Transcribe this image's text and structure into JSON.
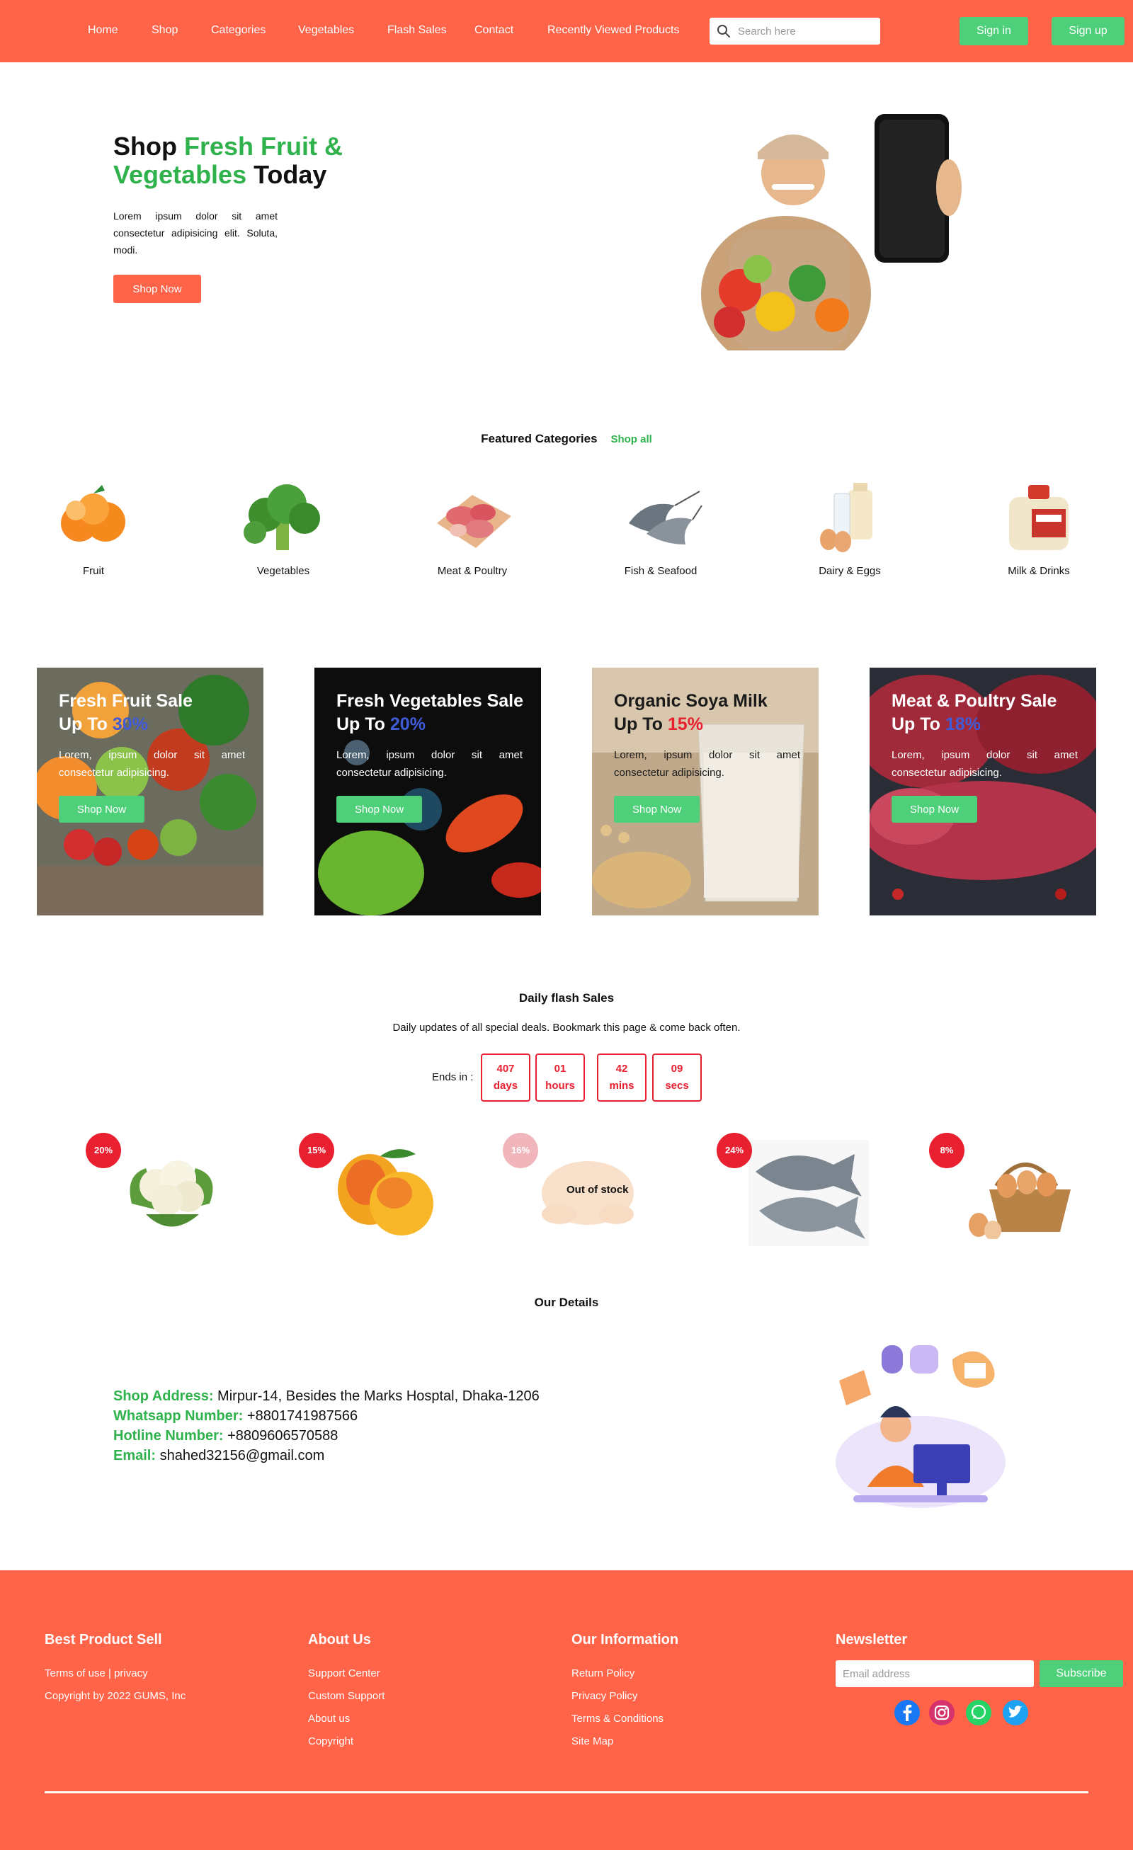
{
  "nav": {
    "items": [
      "Home",
      "Shop",
      "Categories",
      "Vegetables",
      "Flash Sales",
      "Contact",
      "Recently Viewed Products"
    ],
    "search_placeholder": "Search here",
    "signin": "Sign in",
    "signup": "Sign up"
  },
  "hero": {
    "title_pre": "Shop ",
    "title_green1": "Fresh Fruit &",
    "title_green2": "Vegetables",
    "title_post": " Today",
    "description": "Lorem ipsum dolor sit amet consectetur adipisicing elit. Soluta, modi.",
    "cta": "Shop Now"
  },
  "featured": {
    "title": "Featured Categories",
    "shop_all": "Shop all",
    "categories": [
      "Fruit",
      "Vegetables",
      "Meat & Poultry",
      "Fish & Seafood",
      "Dairy & Eggs",
      "Milk & Drinks"
    ]
  },
  "promos": [
    {
      "title": "Fresh Fruit Sale",
      "up_to": "Up To ",
      "pct": "30%",
      "pct_color": "#3f5bd8",
      "desc": "Lorem, ipsum dolor sit amet consectetur adipisicing.",
      "cta": "Shop Now"
    },
    {
      "title": "Fresh Vegetables Sale",
      "up_to": "Up To ",
      "pct": "20%",
      "pct_color": "#3f5bd8",
      "desc": "Lorem, ipsum dolor sit amet consectetur adipisicing.",
      "cta": "Shop Now"
    },
    {
      "title": "Organic Soya Milk",
      "up_to": "Up To ",
      "pct": "15%",
      "pct_color": "#e82030",
      "desc": "Lorem, ipsum dolor sit amet consectetur adipisicing.",
      "cta": "Shop Now"
    },
    {
      "title": "Meat & Poultry Sale",
      "up_to": "Up To ",
      "pct": "18%",
      "pct_color": "#3f5bd8",
      "desc": "Lorem, ipsum dolor sit amet consectetur adipisicing.",
      "cta": "Shop Now"
    }
  ],
  "flash": {
    "title": "Daily flash Sales",
    "subtitle": "Daily updates of all special deals. Bookmark this page & come back often.",
    "ends_in": "Ends in :",
    "timers": [
      {
        "value": "407",
        "unit": "days"
      },
      {
        "value": "01",
        "unit": "hours"
      },
      {
        "value": "42",
        "unit": "mins"
      },
      {
        "value": "09",
        "unit": "secs"
      }
    ],
    "products": [
      {
        "discount": "20%",
        "icon": "cauliflower-image"
      },
      {
        "discount": "15%",
        "icon": "mango-image"
      },
      {
        "discount": "16%",
        "icon": "chicken-image",
        "status": "Out of stock"
      },
      {
        "discount": "24%",
        "icon": "fish-image"
      },
      {
        "discount": "8%",
        "icon": "eggs-basket-image"
      }
    ]
  },
  "details": {
    "title": "Our Details",
    "rows": [
      {
        "key": "Shop Address:",
        "value": " Mirpur-14, Besides the Marks Hosptal, Dhaka-1206"
      },
      {
        "key": "Whatsapp Number:",
        "value": " +8801741987566"
      },
      {
        "key": "Hotline Number:",
        "value": " +8809606570588"
      },
      {
        "key": "Email:",
        "value": " shahed32156@gmail.com"
      }
    ]
  },
  "footer": {
    "col1": {
      "title": "Best Product Sell",
      "links": [
        "Terms of use | privacy",
        "Copyright by 2022 GUMS, Inc"
      ]
    },
    "col2": {
      "title": "About Us",
      "links": [
        "Support Center",
        "Custom Support",
        "About us",
        "Copyright"
      ]
    },
    "col3": {
      "title": "Our Information",
      "links": [
        "Return Policy",
        "Privacy Policy",
        "Terms & Conditions",
        "Site Map"
      ]
    },
    "newsletter": {
      "title": "Newsletter",
      "placeholder": "Email address",
      "button": "Subscribe"
    },
    "social": [
      "facebook-icon",
      "instagram-icon",
      "whatsapp-icon",
      "twitter-icon"
    ]
  },
  "colors": {
    "brand": "#ff6348",
    "accent": "#4ecf7a",
    "green_text": "#2fb24c",
    "danger": "#e82030"
  }
}
